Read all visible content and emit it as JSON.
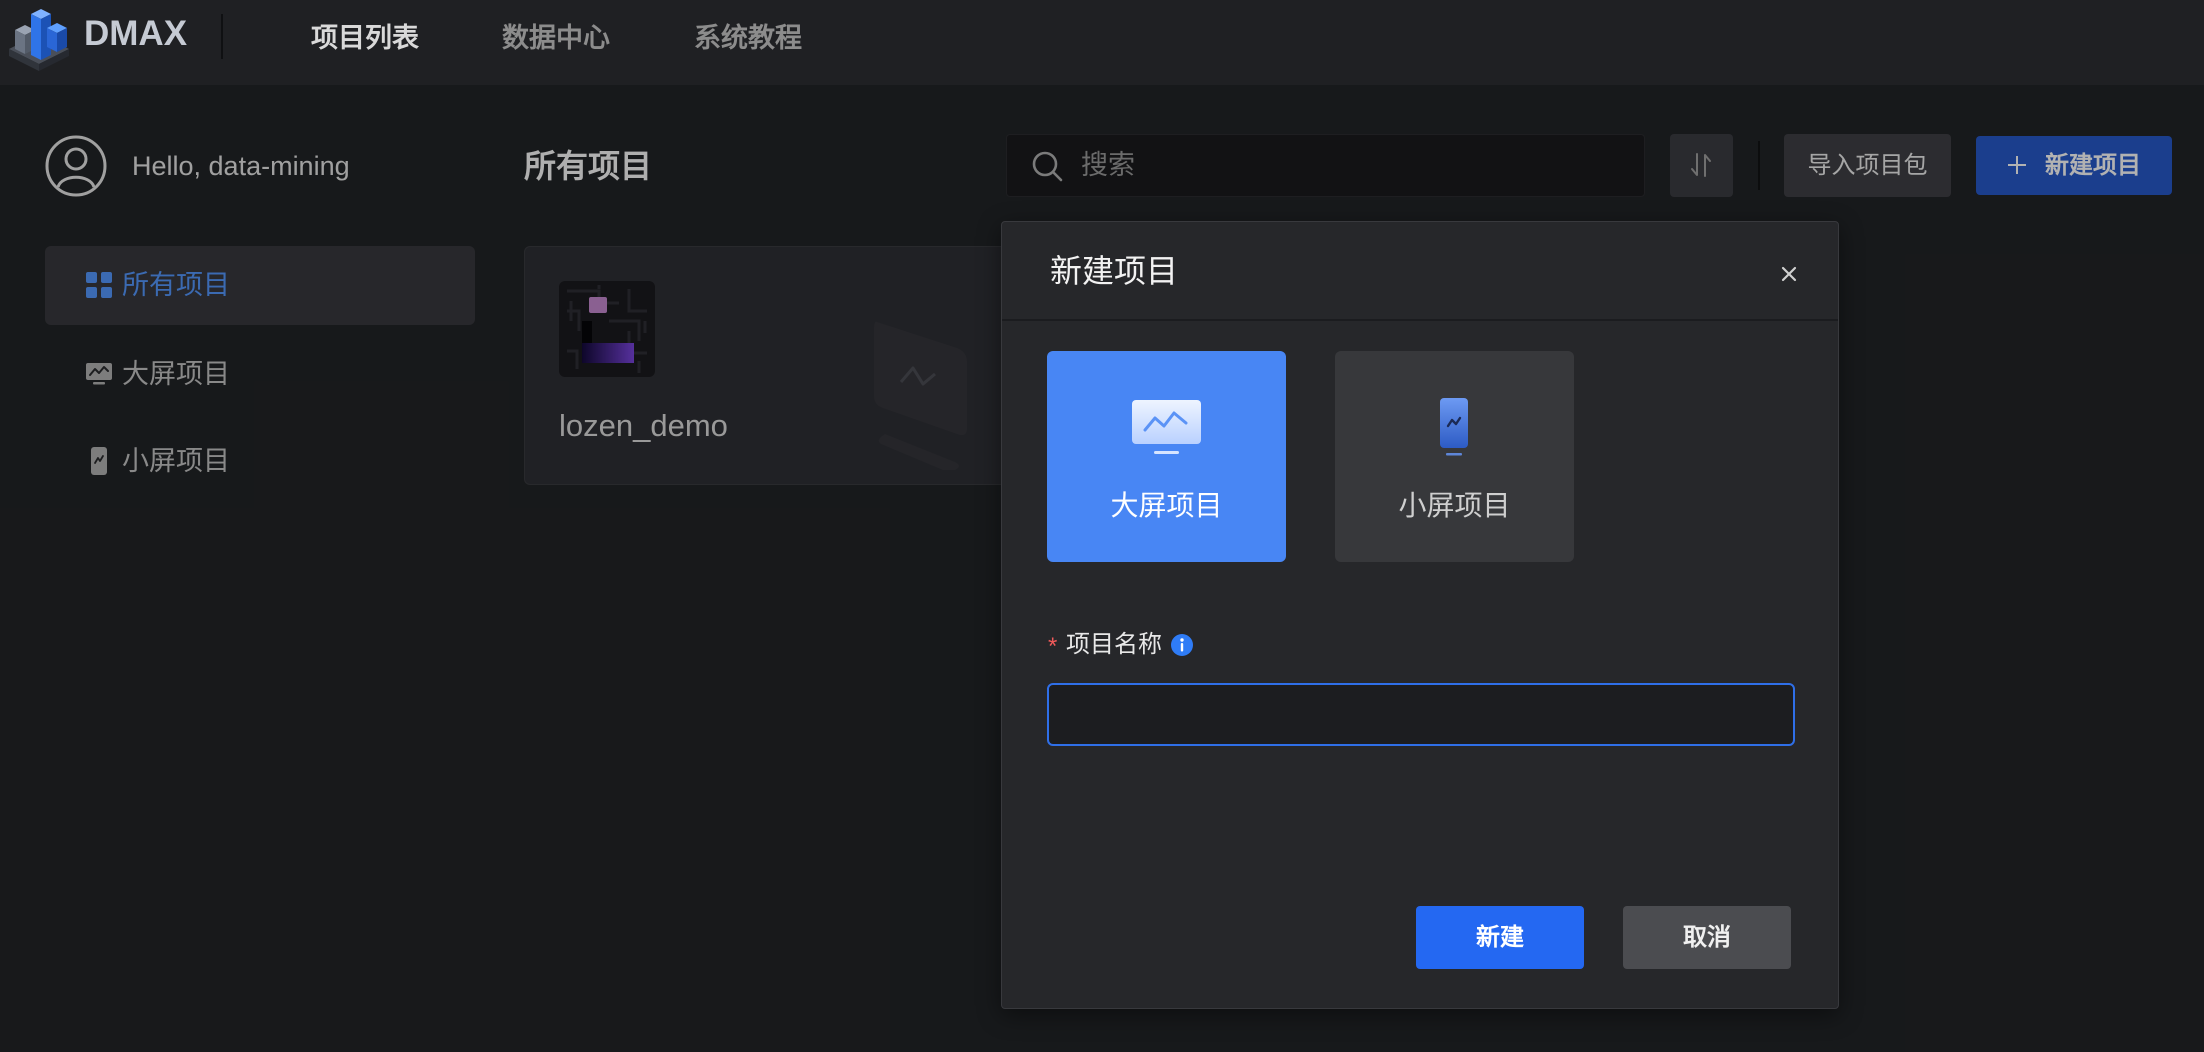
{
  "app": {
    "logo_text": "DMAX",
    "logo_icon": "dmax-cube-logo-icon"
  },
  "nav": {
    "items": [
      {
        "label": "项目列表",
        "active": true
      },
      {
        "label": "数据中心",
        "active": false
      },
      {
        "label": "系统教程",
        "active": false
      }
    ]
  },
  "user": {
    "greeting": "Hello, data-mining",
    "avatar_icon": "user-avatar-icon"
  },
  "sidebar": {
    "items": [
      {
        "label": "所有项目",
        "icon": "grid-icon",
        "active": true
      },
      {
        "label": "大屏项目",
        "icon": "monitor-icon",
        "active": false
      },
      {
        "label": "小屏项目",
        "icon": "phone-icon",
        "active": false
      }
    ]
  },
  "main": {
    "title": "所有项目"
  },
  "toolbar": {
    "search_placeholder": "搜索",
    "search_icon": "search-icon",
    "sort_icon": "sort-icon",
    "import_label": "导入项目包",
    "new_label": "新建项目",
    "new_icon": "plus-icon"
  },
  "projects": [
    {
      "name": "lozen_demo",
      "thumbnail_icon": "project-thumbnail-icon"
    }
  ],
  "modal": {
    "title": "新建项目",
    "close_icon": "close-icon",
    "type_options": [
      {
        "label": "大屏项目",
        "icon": "large-screen-icon",
        "selected": true
      },
      {
        "label": "小屏项目",
        "icon": "small-screen-icon",
        "selected": false
      }
    ],
    "field": {
      "required_mark": "*",
      "label": "项目名称",
      "required": true,
      "info_icon": "info-icon",
      "value": ""
    },
    "confirm_label": "新建",
    "cancel_label": "取消"
  },
  "colors": {
    "primary": "#2468f2",
    "selected_type_card": "#4886f4",
    "required_mark": "#f05a5a",
    "info_icon": "#2f7cf6",
    "modal_background": "#26272a",
    "nav_background": "#1f2023"
  }
}
